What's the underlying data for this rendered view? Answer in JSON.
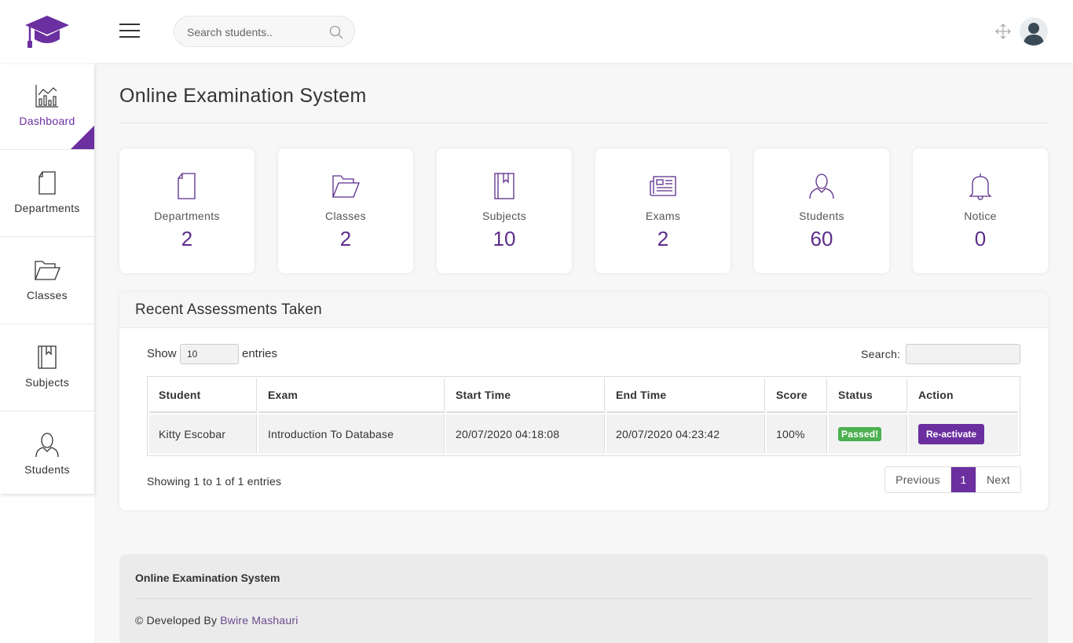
{
  "header": {
    "search_placeholder": "Search students..",
    "brand_color": "#6b2fa0"
  },
  "sidebar": {
    "items": [
      {
        "label": "Dashboard",
        "icon": "chart-icon",
        "active": true
      },
      {
        "label": "Departments",
        "icon": "document-icon"
      },
      {
        "label": "Classes",
        "icon": "folder-icon"
      },
      {
        "label": "Subjects",
        "icon": "book-icon"
      },
      {
        "label": "Students",
        "icon": "user-icon"
      }
    ]
  },
  "main": {
    "title": "Online Examination System",
    "stats": [
      {
        "label": "Departments",
        "value": "2",
        "icon": "document-icon"
      },
      {
        "label": "Classes",
        "value": "2",
        "icon": "folder-icon"
      },
      {
        "label": "Subjects",
        "value": "10",
        "icon": "book-icon"
      },
      {
        "label": "Exams",
        "value": "2",
        "icon": "newspaper-icon"
      },
      {
        "label": "Students",
        "value": "60",
        "icon": "user-icon"
      },
      {
        "label": "Notice",
        "value": "0",
        "icon": "bell-icon"
      }
    ],
    "assessments": {
      "title": "Recent Assessments Taken",
      "show_label": "Show",
      "page_size": "10",
      "entries_label": "entries",
      "search_label": "Search:",
      "columns": [
        "Student",
        "Exam",
        "Start Time",
        "End Time",
        "Score",
        "Status",
        "Action"
      ],
      "rows": [
        {
          "student": "Kitty Escobar",
          "exam": "Introduction To Database",
          "start": "20/07/2020 04:18:08",
          "end": "20/07/2020 04:23:42",
          "score": "100%",
          "status": "Passed!",
          "action": "Re-activate"
        }
      ],
      "info": "Showing 1 to 1 of 1 entries",
      "pagination": {
        "previous": "Previous",
        "current": "1",
        "next": "Next"
      }
    }
  },
  "footer": {
    "title": "Online Examination System",
    "credit_prefix": "© Developed By",
    "credit_name": "Bwire Mashauri"
  }
}
